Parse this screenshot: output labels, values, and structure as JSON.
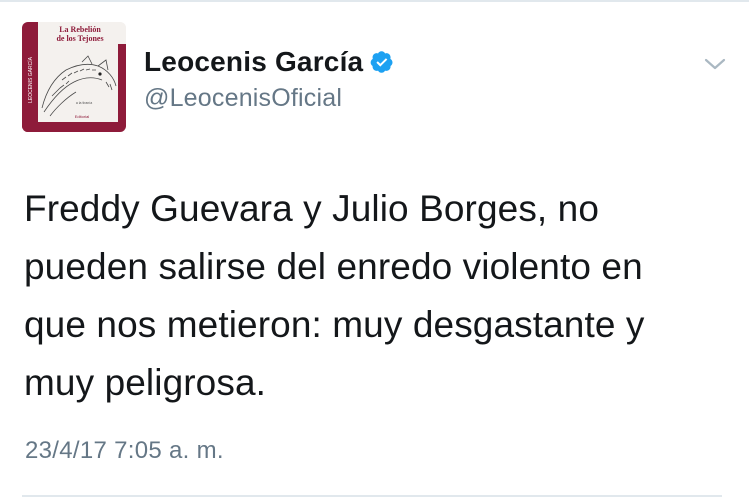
{
  "avatar": {
    "title_line1": "La Rebelión",
    "title_line2": "de los Tejones",
    "author_vertical": "LEOCENIS GARCÍA",
    "subtitle": "a la tiranía",
    "publisher": "Editorial"
  },
  "user": {
    "display_name": "Leocenis García",
    "handle": "@LeocenisOficial",
    "verified_icon": "verified-badge-icon"
  },
  "tweet": {
    "text": "Freddy Guevara y Julio Borges, no\npueden salirse del enredo violento  en\nque nos metieron: muy desgastante y\nmuy peligrosa.",
    "timestamp": "23/4/17 7:05 a. m."
  },
  "colors": {
    "verified": "#1da1f2",
    "muted": "#657786",
    "text": "#14171a",
    "book_red": "#8e1b3a"
  }
}
